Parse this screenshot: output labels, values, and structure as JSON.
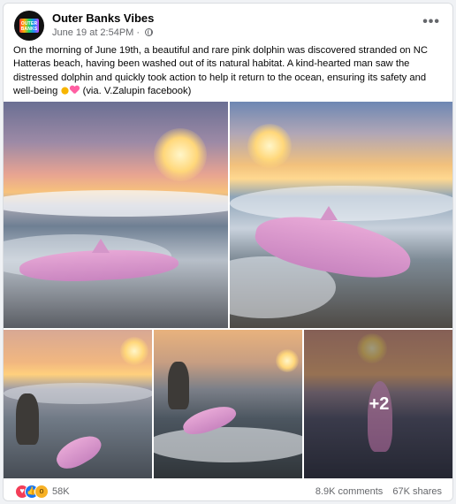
{
  "post": {
    "page_name": "Outer Banks Vibes",
    "avatar_text": "OUTER BANKS",
    "timestamp": "June 19 at 2:54PM",
    "separator": "·",
    "more_label": "•••",
    "text": "On the morning of June 19th, a beautiful and rare pink dolphin was discovered stranded on NC Hatteras beach, having been washed out of its natural habitat. A kind-hearted man saw the distressed dolphin and quickly took action to help it return to the ocean, ensuring its safety and well-being",
    "text_suffix": "(via. V.Zalupin facebook)"
  },
  "photos": {
    "more_count_label": "+2"
  },
  "footer": {
    "reaction_count": "58K",
    "comments": "8.9K comments",
    "shares": "67K shares"
  },
  "reaction_icons": [
    "love-icon",
    "like-icon",
    "wow-icon"
  ],
  "colors": {
    "reaction_love": "#f33e58",
    "reaction_like": "#1877f2",
    "reaction_wow": "#f7b125",
    "muted_text": "#65676b"
  }
}
